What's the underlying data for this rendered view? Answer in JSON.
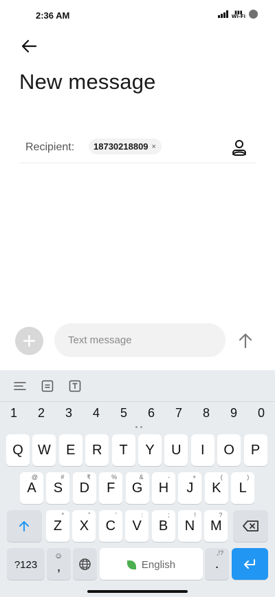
{
  "status_bar": {
    "time": "2:36 AM",
    "wifi_label": "Wi-Fi"
  },
  "header": {
    "title": "New message"
  },
  "recipient": {
    "label": "Recipient:",
    "chip_number": "18730218809",
    "chip_close": "×"
  },
  "compose": {
    "placeholder": "Text message"
  },
  "keyboard": {
    "numbers": [
      "1",
      "2",
      "3",
      "4",
      "5",
      "6",
      "7",
      "8",
      "9",
      "0"
    ],
    "row1": [
      "Q",
      "W",
      "E",
      "R",
      "T",
      "Y",
      "U",
      "I",
      "O",
      "P"
    ],
    "row2": [
      {
        "label": "A",
        "hint": "@"
      },
      {
        "label": "S",
        "hint": "#"
      },
      {
        "label": "D",
        "hint": "₹"
      },
      {
        "label": "F",
        "hint": "%"
      },
      {
        "label": "G",
        "hint": "&"
      },
      {
        "label": "H",
        "hint": "-"
      },
      {
        "label": "J",
        "hint": "+"
      },
      {
        "label": "K",
        "hint": "("
      },
      {
        "label": "L",
        "hint": ")"
      }
    ],
    "row3": [
      {
        "label": "Z",
        "hint": "*"
      },
      {
        "label": "X",
        "hint": "\""
      },
      {
        "label": "C",
        "hint": "'"
      },
      {
        "label": "V",
        "hint": ":"
      },
      {
        "label": "B",
        "hint": ";"
      },
      {
        "label": "N",
        "hint": "!"
      },
      {
        "label": "M",
        "hint": "?"
      }
    ],
    "symbols_label": "?123",
    "comma": ",",
    "space_label": "English",
    "period": ".",
    "period_hint": ",!?",
    "accent_color": "#2196f3"
  }
}
